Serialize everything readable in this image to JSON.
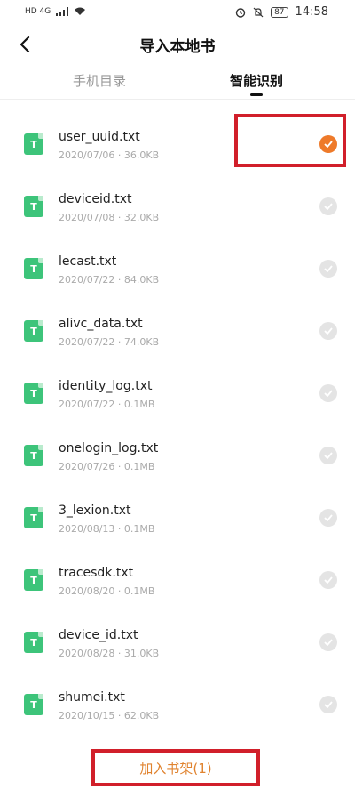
{
  "status_bar": {
    "network_left": "HD 4G",
    "battery": "87",
    "time": "14:58"
  },
  "header": {
    "title": "导入本地书",
    "back_icon": "back-arrow-icon"
  },
  "tabs": [
    {
      "label": "手机目录",
      "active": false
    },
    {
      "label": "智能识别",
      "active": true
    }
  ],
  "files": [
    {
      "name": "user_uuid.txt",
      "meta": "2020/07/06 · 36.0KB",
      "icon_letter": "T",
      "selected": true
    },
    {
      "name": "deviceid.txt",
      "meta": "2020/07/08 · 32.0KB",
      "icon_letter": "T",
      "selected": false
    },
    {
      "name": "lecast.txt",
      "meta": "2020/07/22 · 84.0KB",
      "icon_letter": "T",
      "selected": false
    },
    {
      "name": "alivc_data.txt",
      "meta": "2020/07/22 · 74.0KB",
      "icon_letter": "T",
      "selected": false
    },
    {
      "name": "identity_log.txt",
      "meta": "2020/07/22 · 0.1MB",
      "icon_letter": "T",
      "selected": false
    },
    {
      "name": "onelogin_log.txt",
      "meta": "2020/07/26 · 0.1MB",
      "icon_letter": "T",
      "selected": false
    },
    {
      "name": "3_lexion.txt",
      "meta": "2020/08/13 · 0.1MB",
      "icon_letter": "T",
      "selected": false
    },
    {
      "name": "tracesdk.txt",
      "meta": "2020/08/20 · 0.1MB",
      "icon_letter": "T",
      "selected": false
    },
    {
      "name": "device_id.txt",
      "meta": "2020/08/28 · 31.0KB",
      "icon_letter": "T",
      "selected": false
    },
    {
      "name": "shumei.txt",
      "meta": "2020/10/15 · 62.0KB",
      "icon_letter": "T",
      "selected": false
    }
  ],
  "add_button_label": "加入书架(1)",
  "colors": {
    "accent": "#ee7a2a",
    "file_icon": "#3dc47a",
    "annotation": "#d11f2a"
  }
}
